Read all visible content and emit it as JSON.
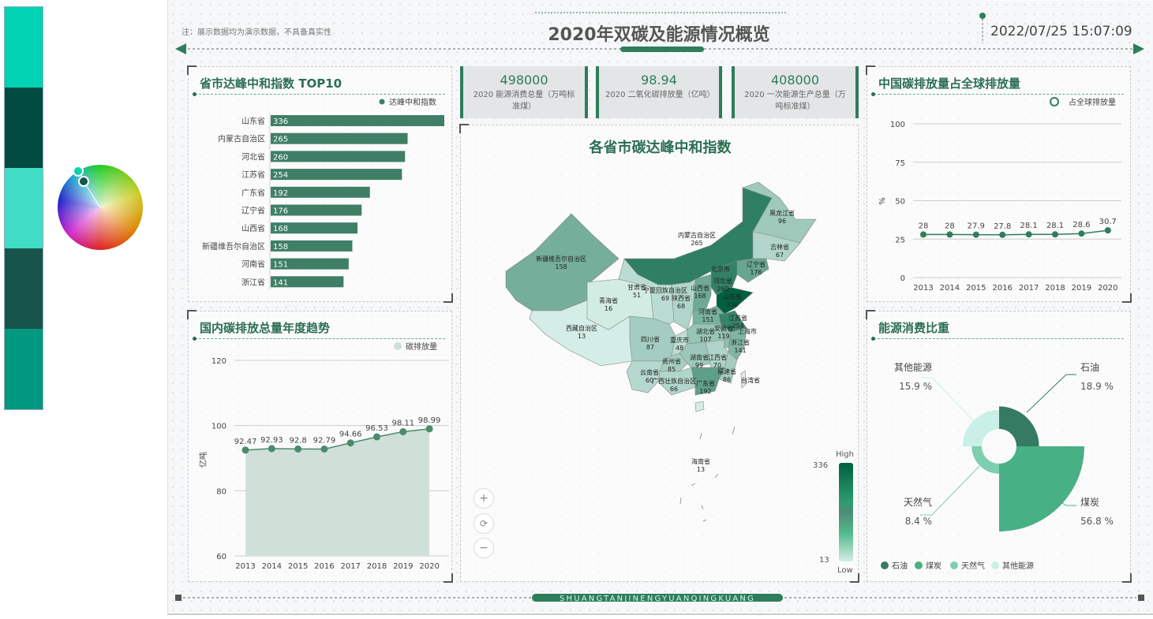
{
  "palette": {
    "colors": [
      "#00d2b3",
      "#014b40",
      "#40dcc5",
      "#17554c",
      "#00997f"
    ]
  },
  "header": {
    "note": "注：展示数据均为演示数据，不具备真实性",
    "title": "2020年双碳及能源情况概览",
    "datetime": "2022/07/25 15:07:09"
  },
  "kpis": [
    {
      "value": "498000",
      "label": "2020 能源消费总量（万吨标准煤）"
    },
    {
      "value": "98.94",
      "label": "2020 二氧化碳排放量（亿吨）"
    },
    {
      "value": "408000",
      "label": "2020 一次能源生产总量（万吨标准煤）"
    }
  ],
  "panels": {
    "top10": "省市达峰中和指数 TOP10",
    "trend": "国内碳排放总量年度趋势",
    "global": "中国碳排放量占全球排放量",
    "energy": "能源消费比重"
  },
  "colors": {
    "bar": "#3f7f66",
    "area_line": "#4c8a6c",
    "area_fill": "#cfe0d9",
    "line": "#2f7d5a",
    "oil": "#357a62",
    "coal": "#48b085",
    "gas": "#7dcfaf",
    "other": "#c9efe6",
    "map_low": "#d4ede6",
    "map_high": "#00603f"
  },
  "chart_data": [
    {
      "type": "bar",
      "title": "省市达峰中和指数 TOP10",
      "legend": "达峰中和指数",
      "categories": [
        "山东省",
        "内蒙古自治区",
        "河北省",
        "江苏省",
        "广东省",
        "辽宁省",
        "山西省",
        "新疆维吾尔自治区",
        "河南省",
        "浙江省"
      ],
      "values": [
        336,
        265,
        260,
        254,
        192,
        176,
        168,
        158,
        151,
        141
      ],
      "xlim": [
        0,
        336
      ]
    },
    {
      "type": "area",
      "title": "国内碳排放总量年度趋势",
      "legend": "碳排放量",
      "ylabel": "亿吨",
      "categories": [
        "2013",
        "2014",
        "2015",
        "2016",
        "2017",
        "2018",
        "2019",
        "2020"
      ],
      "values": [
        92.47,
        92.93,
        92.8,
        92.79,
        94.66,
        96.53,
        98.11,
        98.99
      ],
      "ylim": [
        60,
        120
      ],
      "yticks": [
        "60",
        "80",
        "100",
        "120"
      ],
      "grid": true
    },
    {
      "type": "line",
      "title": "中国碳排放量占全球排放量",
      "legend": "占全球排放量",
      "ylabel": "%",
      "categories": [
        "2013",
        "2014",
        "2015",
        "2016",
        "2017",
        "2018",
        "2019",
        "2020"
      ],
      "values": [
        28,
        28,
        27.9,
        27.8,
        28.1,
        28.1,
        28.6,
        30.7
      ],
      "ylim": [
        0,
        100
      ],
      "yticks": [
        "0",
        "25",
        "50",
        "75",
        "100"
      ],
      "grid": true
    },
    {
      "type": "pie",
      "title": "能源消费比重",
      "categories": [
        "石油",
        "煤炭",
        "天然气",
        "其他能源"
      ],
      "values": [
        18.9,
        56.8,
        8.4,
        15.9
      ],
      "labels": [
        "18.9 %",
        "56.8 %",
        "8.4 %",
        "15.9 %"
      ],
      "legend": "bottom-left"
    }
  ],
  "map": {
    "title": "各省市碳达峰中和指数",
    "high": "High",
    "low": "Low",
    "max": 336,
    "min": 13,
    "max_label": "336",
    "min_label": "13",
    "provinces": [
      {
        "name": "新疆维吾尔自治区",
        "value": 158,
        "label": "158"
      },
      {
        "name": "西藏自治区",
        "value": 13,
        "label": "13"
      },
      {
        "name": "青海省",
        "value": 16,
        "label": "16"
      },
      {
        "name": "甘肃省",
        "value": 51,
        "label": "51"
      },
      {
        "name": "内蒙古自治区",
        "value": 265,
        "label": "265"
      },
      {
        "name": "黑龙江省",
        "value": 96,
        "label": "96"
      },
      {
        "name": "吉林省",
        "value": 67,
        "label": "67"
      },
      {
        "name": "辽宁省",
        "value": 176,
        "label": "176"
      },
      {
        "name": "河北省",
        "value": 260,
        "label": "260"
      },
      {
        "name": "山西省",
        "value": 168,
        "label": "168"
      },
      {
        "name": "山东省",
        "value": 336,
        "label": "336"
      },
      {
        "name": "陕西省",
        "value": 68,
        "label": "68"
      },
      {
        "name": "四川省",
        "value": 87,
        "label": "87"
      },
      {
        "name": "河南省",
        "value": 151,
        "label": "151"
      },
      {
        "name": "湖北省",
        "value": 107,
        "label": "107"
      },
      {
        "name": "江苏省",
        "value": 254,
        "label": "254"
      },
      {
        "name": "云南省",
        "value": 60,
        "label": "60"
      },
      {
        "name": "贵州省",
        "value": 85,
        "label": "85"
      },
      {
        "name": "湖南省",
        "value": 99,
        "label": "99"
      },
      {
        "name": "江西省",
        "value": 70,
        "label": "70"
      },
      {
        "name": "福建省",
        "value": 86,
        "label": "86"
      },
      {
        "name": "广西壮族自治区",
        "value": 66,
        "label": "66"
      },
      {
        "name": "广东省",
        "value": 192,
        "label": "192"
      },
      {
        "name": "海南省",
        "value": 13,
        "label": "13"
      },
      {
        "name": "台湾省",
        "value": null,
        "label": ""
      },
      {
        "name": "浙江省",
        "value": 141,
        "label": "141"
      },
      {
        "name": "安徽省",
        "value": 119,
        "label": "119"
      },
      {
        "name": "重庆市",
        "value": 48,
        "label": "48"
      },
      {
        "name": "宁夏回族自治区",
        "value": 69,
        "label": "69"
      },
      {
        "name": "北京市",
        "value": null,
        "label": ""
      },
      {
        "name": "上海市",
        "value": null,
        "label": ""
      }
    ]
  },
  "map_controls": {
    "zoom_in": "+",
    "reset": "⟳",
    "zoom_out": "−"
  },
  "footer": {
    "text": "SHUANGTANJINENGYUANQINGKUANG"
  }
}
